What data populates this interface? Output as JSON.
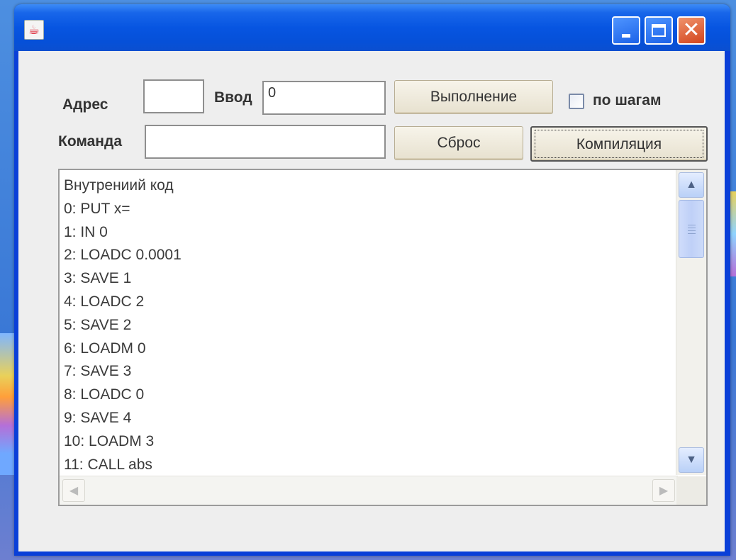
{
  "window": {
    "title": "",
    "controls": {
      "minimize": "minimize",
      "maximize": "maximize",
      "close": "close"
    }
  },
  "form": {
    "address_label": "Адрес",
    "address_value": "",
    "input_label": "Ввод",
    "input_value": "0",
    "command_label": "Команда",
    "command_value": "",
    "execute_button": "Выполнение",
    "step_checkbox_label": "по шагам",
    "step_checked": false,
    "reset_button": "Сброс",
    "compile_button": "Компиляция"
  },
  "code_view": {
    "lines": [
      "Внутрениий код",
      "0: PUT x=",
      "1: IN 0",
      "2: LOADC 0.0001",
      "3: SAVE 1",
      "4: LOADC 2",
      "5: SAVE 2",
      "6: LOADM 0",
      "7: SAVE 3",
      "8: LOADC 0",
      "9: SAVE 4",
      "10: LOADM 3",
      "11: CALL abs"
    ]
  },
  "icons": {
    "app": "java-cup-icon",
    "scroll_up": "chevron-up-icon",
    "scroll_down": "chevron-down-icon",
    "scroll_left": "chevron-left-icon",
    "scroll_right": "chevron-right-icon"
  }
}
